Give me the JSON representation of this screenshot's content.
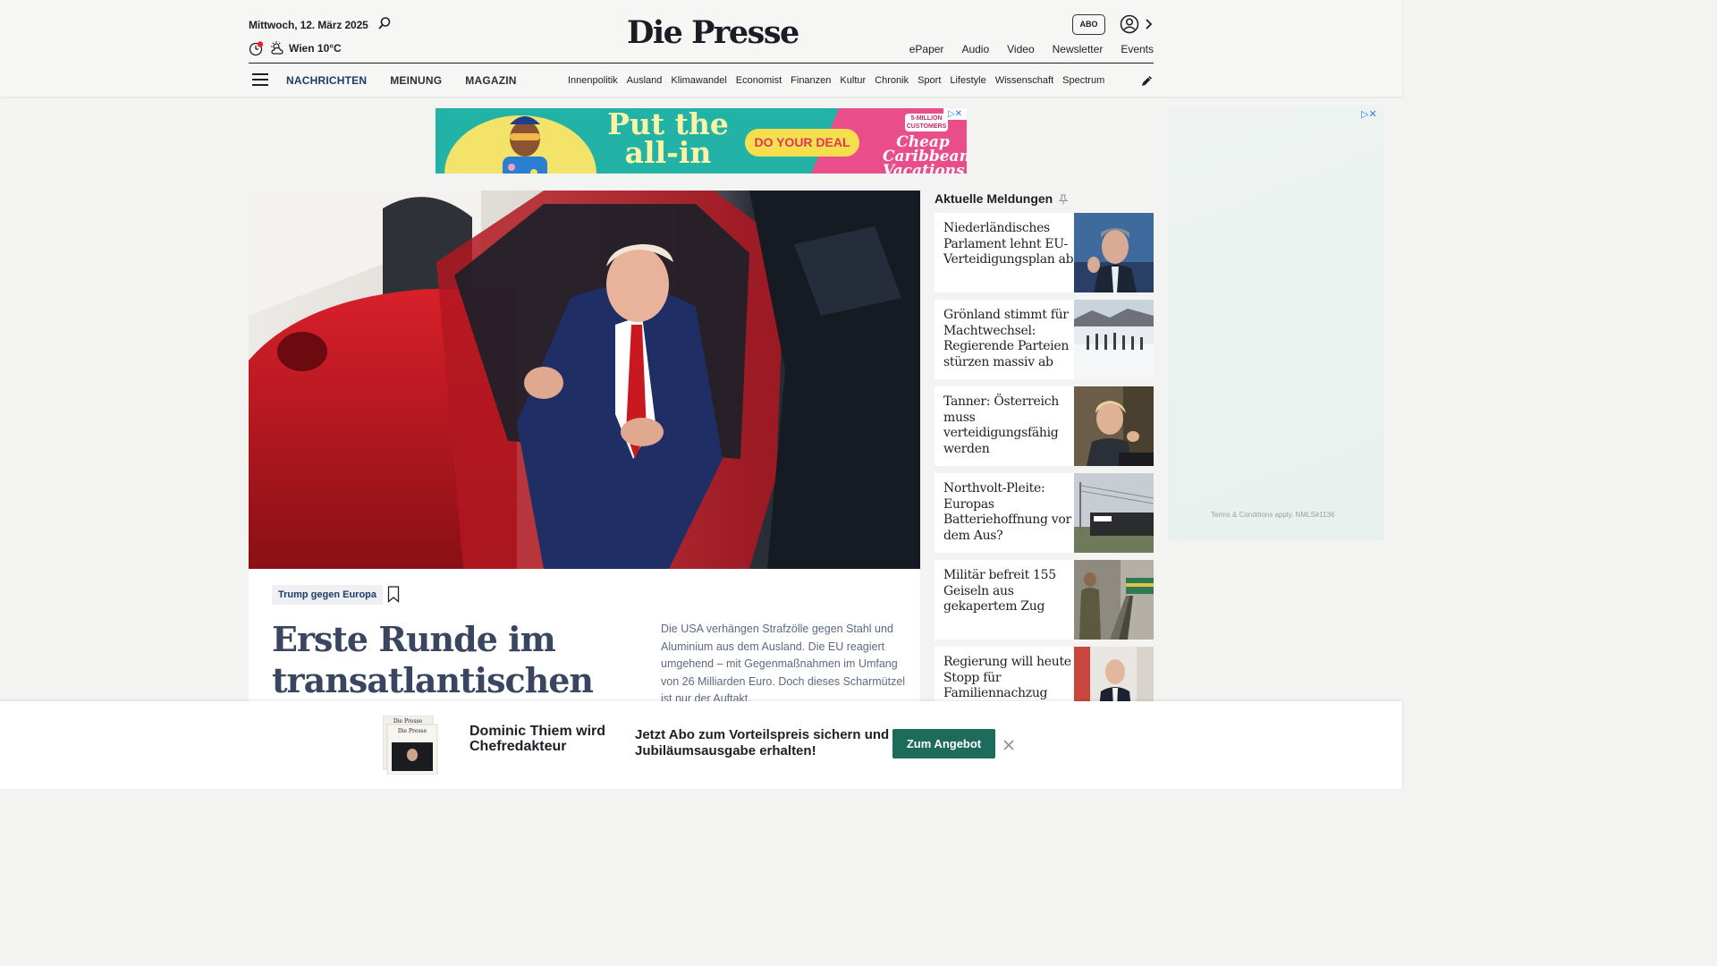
{
  "header": {
    "date": "Mittwoch, 12. März 2025",
    "weather": "Wien 10°C",
    "logo": "Die Presse",
    "abo_label": "ABO",
    "top_links": [
      "ePaper",
      "Audio",
      "Video",
      "Newsletter",
      "Events"
    ]
  },
  "nav": {
    "main": [
      "NACHRICHTEN",
      "MEINUNG",
      "MAGAZIN"
    ],
    "sub": [
      "Innenpolitik",
      "Ausland",
      "Klimawandel",
      "Economist",
      "Finanzen",
      "Kultur",
      "Chronik",
      "Sport",
      "Lifestyle",
      "Wissenschaft",
      "Spectrum"
    ]
  },
  "ad": {
    "headline": "Put the all-in",
    "cta": "DO YOUR DEAL",
    "badge": "5-MILLION CUSTOMERS",
    "brand": "Cheap Caribbean Vacations",
    "terms": "Terms & Conditions apply. NMLS#1136"
  },
  "hero": {
    "tag": "Trump gegen Europa",
    "headline": "Erste Runde im transatlantischen",
    "lead": "Die USA verhängen Strafzölle gegen Stahl und Aluminium aus dem Ausland. Die EU reagiert umgehend – mit Gegenmaßnahmen im Umfang von 26 Milliarden Euro. Doch dieses Scharmützel ist nur der Auftakt."
  },
  "sidebar": {
    "title": "Aktuelle Meldungen",
    "items": [
      {
        "title": "Niederländisches Parlament lehnt EU-Verteidigungsplan ab"
      },
      {
        "title": "Grönland stimmt für Machtwechsel: Regierende Parteien stürzen massiv ab"
      },
      {
        "title": "Tanner: Österreich muss verteidigungsfähig werden"
      },
      {
        "title": "Northvolt-Pleite: Europas Batteriehoffnung vor dem Aus?"
      },
      {
        "title": "Militär befreit 155 Geiseln aus gekapertem Zug"
      },
      {
        "title": "Regierung will heute Stopp für Familiennachzug"
      }
    ]
  },
  "promo": {
    "headline": "Dominic Thiem wird Chefredakteur",
    "text": "Jetzt Abo zum Vorteilspreis sichern und Jubiläumsausgabe erhalten!",
    "cta": "Zum Angebot",
    "paper_logo": "Die Presse"
  },
  "colors": {
    "accent": "#1d3b67",
    "promo_button": "#1d6b5a",
    "headline": "#3a4660"
  }
}
